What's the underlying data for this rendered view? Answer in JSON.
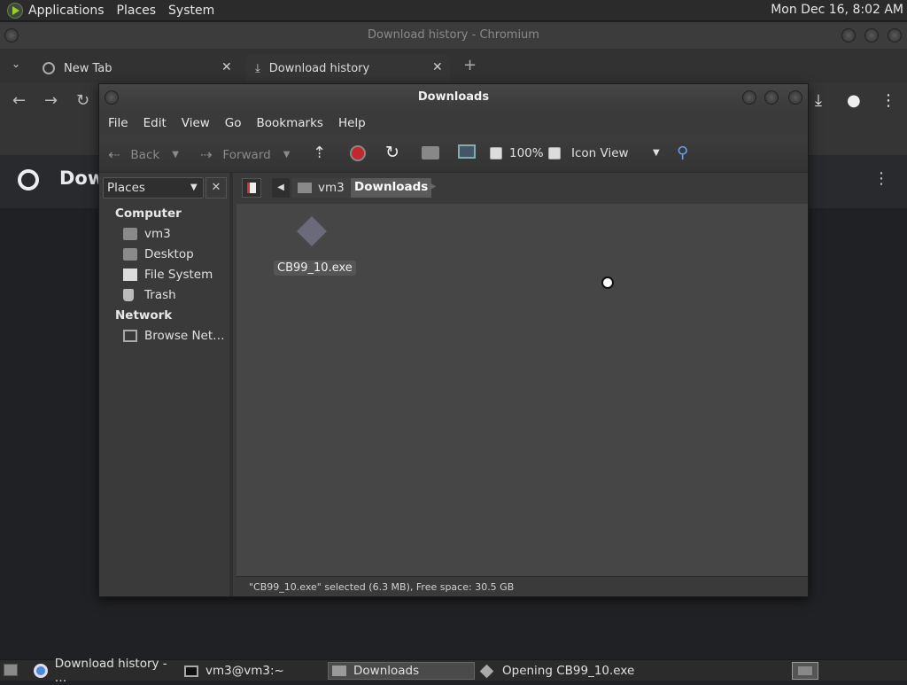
{
  "top_panel": {
    "menus": [
      "Applications",
      "Places",
      "System"
    ],
    "clock": "Mon Dec 16,  8:02 AM"
  },
  "chromium": {
    "window_title": "Download history - Chromium",
    "tabs": [
      {
        "label": "New Tab",
        "icon": "globe-icon"
      },
      {
        "label": "Download history",
        "icon": "download-icon"
      }
    ],
    "page_heading_partial": "Dow"
  },
  "file_manager": {
    "title": "Downloads",
    "menus": [
      "File",
      "Edit",
      "View",
      "Go",
      "Bookmarks",
      "Help"
    ],
    "toolbar": {
      "back": "Back",
      "forward": "Forward",
      "zoom": "100%",
      "view_mode": "Icon View"
    },
    "sidebar": {
      "selector": "Places",
      "sections": [
        {
          "heading": "Computer",
          "items": [
            {
              "label": "vm3",
              "icon": "home-folder-icon"
            },
            {
              "label": "Desktop",
              "icon": "desktop-folder-icon"
            },
            {
              "label": "File System",
              "icon": "drive-icon"
            },
            {
              "label": "Trash",
              "icon": "trash-icon"
            }
          ]
        },
        {
          "heading": "Network",
          "items": [
            {
              "label": "Browse Net…",
              "icon": "network-icon"
            }
          ]
        }
      ]
    },
    "path": [
      "vm3",
      "Downloads"
    ],
    "files": [
      {
        "name": "CB99_10.exe",
        "icon": "exe-icon"
      }
    ],
    "status": "\"CB99_10.exe\" selected (6.3 MB), Free space: 30.5 GB"
  },
  "taskbar": {
    "items": [
      {
        "label": "Download history - …",
        "icon": "chromium-icon"
      },
      {
        "label": "vm3@vm3:~",
        "icon": "terminal-icon"
      },
      {
        "label": "Downloads",
        "icon": "folder-icon"
      },
      {
        "label": "Opening CB99_10.exe",
        "icon": "exe-icon"
      }
    ]
  }
}
